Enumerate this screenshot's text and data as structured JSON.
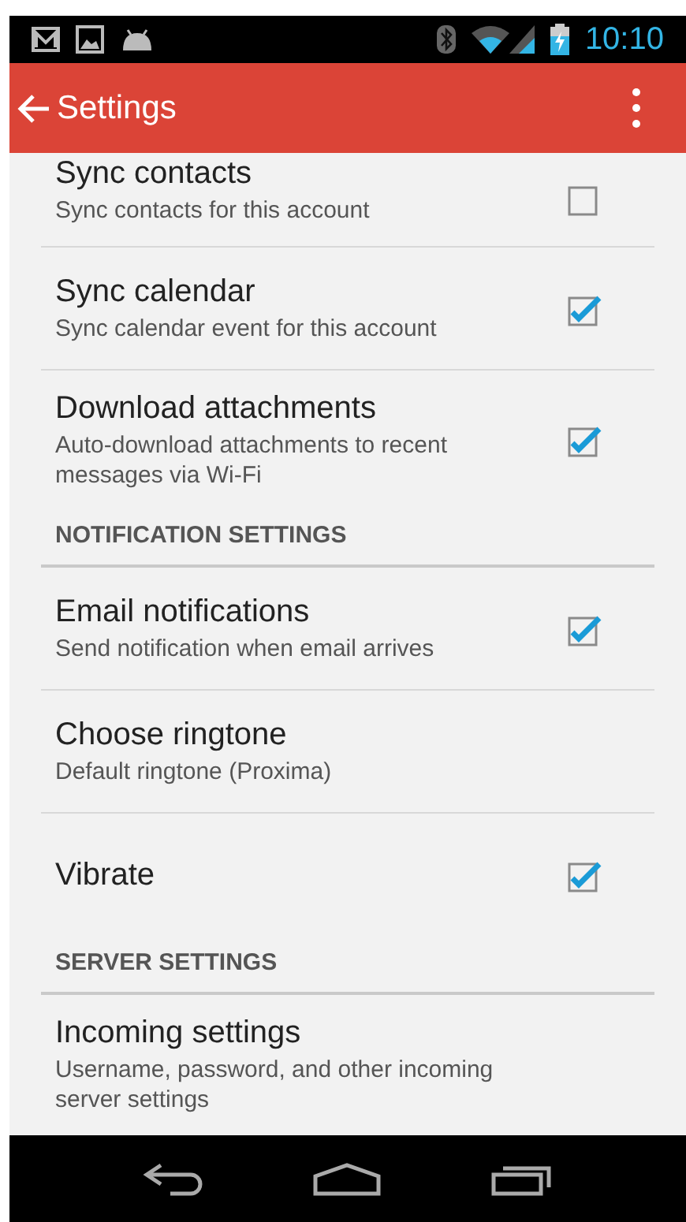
{
  "status_bar": {
    "time": "10:10"
  },
  "app_bar": {
    "title": "Settings"
  },
  "items": [
    {
      "kind": "row",
      "title": "Sync contacts",
      "summary": "Sync contacts for this account",
      "checked": false
    },
    {
      "kind": "row",
      "title": "Sync calendar",
      "summary": "Sync calendar event for this account",
      "checked": true
    },
    {
      "kind": "row",
      "title": "Download attachments",
      "summary": "Auto-download attachments to recent messages via Wi-Fi",
      "checked": true
    },
    {
      "kind": "header",
      "title": "NOTIFICATION SETTINGS"
    },
    {
      "kind": "row",
      "title": "Email notifications",
      "summary": "Send notification when email arrives",
      "checked": true
    },
    {
      "kind": "row",
      "title": "Choose ringtone",
      "summary": "Default ringtone (Proxima)"
    },
    {
      "kind": "row",
      "title": "Vibrate",
      "checked": true
    },
    {
      "kind": "header",
      "title": "SERVER SETTINGS"
    },
    {
      "kind": "row",
      "title": "Incoming settings",
      "summary": "Username, password, and other incoming server settings"
    }
  ]
}
